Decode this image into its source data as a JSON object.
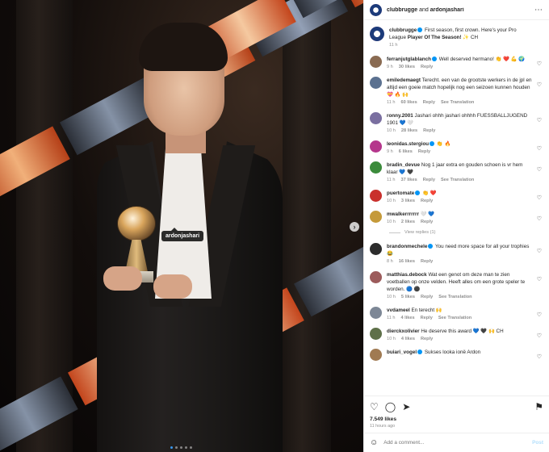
{
  "header": {
    "user1": "clubbrugge",
    "and": " and ",
    "user2": "ardonjashari",
    "more_icon": "more-horizontal-icon"
  },
  "caption": {
    "user": "clubbrugge",
    "text": "First season, first crown. Here's your Pro League ",
    "bold": "Player Of The Season!",
    "suffix": " ✨ CH",
    "time": "11 h"
  },
  "photo": {
    "tag": "ardonjashari",
    "next_icon": "›"
  },
  "comments": [
    {
      "user": "ferranjutglablanch",
      "verified": true,
      "text": "Well deserved hermano! 👏 ❤️ 💪 🌍",
      "time": "9 h",
      "likes": "30 likes",
      "reply": "Reply",
      "translation": "",
      "avatar": "#8a6b52"
    },
    {
      "user": "emiledemaegt",
      "verified": false,
      "text": "Terecht. een van de grootste werkers in de jpl en altijd een goeie match hopelijk nog een seizoen kunnen houden💝 🔥 🙌",
      "time": "11 h",
      "likes": "60 likes",
      "reply": "Reply",
      "translation": "See Translation",
      "avatar": "#5b7190"
    },
    {
      "user": "ronny.2001",
      "verified": false,
      "text": "Jashari ohhh jashari ohhhh FUESSBALLJUGEND 1901 💙 🤍",
      "time": "10 h",
      "likes": "28 likes",
      "reply": "Reply",
      "translation": "",
      "avatar": "#7a6fa0"
    },
    {
      "user": "leonidas.stergiou",
      "verified": true,
      "text": "👏 🔥",
      "time": "9 h",
      "likes": "6 likes",
      "reply": "Reply",
      "translation": "",
      "avatar": "#b5368c"
    },
    {
      "user": "bradin_devue",
      "verified": false,
      "text": "Nog 1 jaar extra en gouden schoen is vr hem klaar 💙 🖤",
      "time": "11 h",
      "likes": "37 likes",
      "reply": "Reply",
      "translation": "See Translation",
      "avatar": "#3b8b3b"
    },
    {
      "user": "puertomate",
      "verified": true,
      "text": "👏 ❤️",
      "time": "10 h",
      "likes": "3 likes",
      "reply": "Reply",
      "translation": "",
      "avatar": "#c9302c"
    },
    {
      "user": "mwalkerrrrrrr",
      "verified": false,
      "text": "🤍 💙",
      "time": "10 h",
      "likes": "2 likes",
      "reply": "Reply",
      "translation": "",
      "avatar": "#c59a3a",
      "view_replies": "View replies (1)"
    },
    {
      "user": "brandonmechele",
      "verified": true,
      "text": "You need more space for all your trophies 😂",
      "time": "8 h",
      "likes": "16 likes",
      "reply": "Reply",
      "translation": "",
      "avatar": "#2c2c2c"
    },
    {
      "user": "matthias.debock",
      "verified": false,
      "text": "Wat een genot om deze man te zien voetballen op onze velden. Heeft alles om een grote speler te worden. 🔵 ⚫",
      "time": "10 h",
      "likes": "5 likes",
      "reply": "Reply",
      "translation": "See Translation",
      "avatar": "#9c5b5b"
    },
    {
      "user": "vvdameel",
      "verified": false,
      "text": "En terecht 🙌",
      "time": "11 h",
      "likes": "4 likes",
      "reply": "Reply",
      "translation": "See Translation",
      "avatar": "#7d8796"
    },
    {
      "user": "dierckxolivier",
      "verified": false,
      "text": "He deserve this award 💙 🖤 🙌 CH",
      "time": "10 h",
      "likes": "4 likes",
      "reply": "Reply",
      "translation": "",
      "avatar": "#5e7049"
    },
    {
      "user": "buiari_vogel",
      "verified": true,
      "text": "Sukses looka ionë Ardon",
      "time": "",
      "likes": "",
      "reply": "",
      "translation": "",
      "avatar": "#a07a52"
    }
  ],
  "actions": {
    "like_icon": "heart-icon",
    "comment_icon": "comment-icon",
    "share_icon": "send-icon",
    "save_icon": "bookmark-icon"
  },
  "likes": "7.549 likes",
  "ago": "11 hours ago",
  "add_comment": {
    "placeholder": "Add a comment...",
    "post": "Post"
  },
  "colors": {
    "accent": "#0095f6",
    "post_disabled": "#b2dffc"
  }
}
